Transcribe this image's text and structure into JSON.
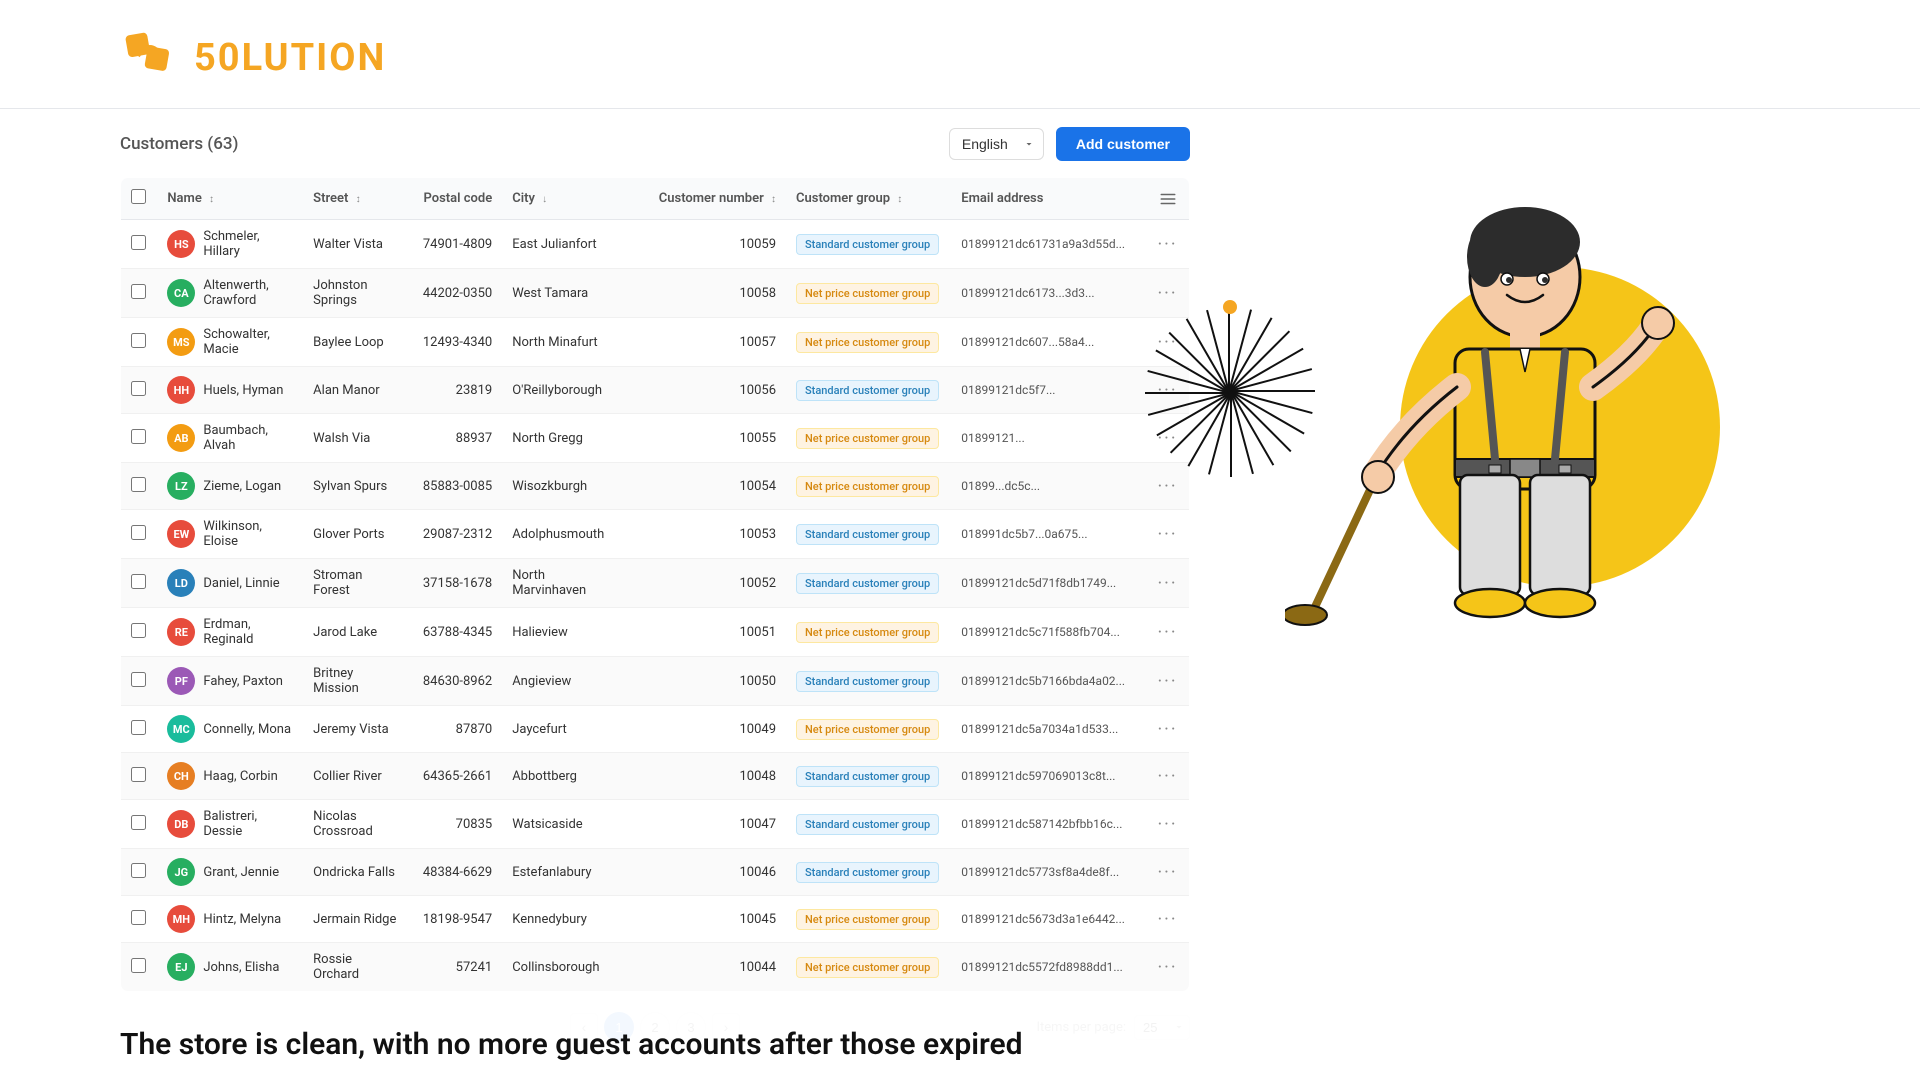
{
  "logo": {
    "text": "50LUTION"
  },
  "toolbar": {
    "title": "Customers (63)",
    "lang_label": "English",
    "add_button": "Add customer"
  },
  "table": {
    "columns": [
      "",
      "Name",
      "Street",
      "Postal code",
      "City",
      "",
      "Customer number",
      "Customer group",
      "Email address",
      ""
    ],
    "rows": [
      {
        "id": 1,
        "initials": "HS",
        "avatar_color": "#e74c3c",
        "name": "Schmeler, Hillary",
        "street": "Walter Vista",
        "postal": "74901-4809",
        "city": "East Julianfort",
        "custnum": "10059",
        "group": "Standard customer group",
        "group_type": "standard",
        "email": "01899121dc61731a9a3d55d..."
      },
      {
        "id": 2,
        "initials": "CA",
        "avatar_color": "#27ae60",
        "name": "Altenwerth, Crawford",
        "street": "Johnston Springs",
        "postal": "44202-0350",
        "city": "West Tamara",
        "custnum": "10058",
        "group": "Net price customer group",
        "group_type": "net",
        "email": "01899121dc6173...3d3..."
      },
      {
        "id": 3,
        "initials": "MS",
        "avatar_color": "#f39c12",
        "name": "Schowalter, Macie",
        "street": "Baylee Loop",
        "postal": "12493-4340",
        "city": "North Minafurt",
        "custnum": "10057",
        "group": "Net price customer group",
        "group_type": "net",
        "email": "01899121dc607...58a4..."
      },
      {
        "id": 4,
        "initials": "HH",
        "avatar_color": "#e74c3c",
        "name": "Huels, Hyman",
        "street": "Alan Manor",
        "postal": "23819",
        "city": "O'Reillyborough",
        "custnum": "10056",
        "group": "Standard customer group",
        "group_type": "standard",
        "email": "01899121dc5f7..."
      },
      {
        "id": 5,
        "initials": "AB",
        "avatar_color": "#f39c12",
        "name": "Baumbach, Alvah",
        "street": "Walsh Via",
        "postal": "88937",
        "city": "North Gregg",
        "custnum": "10055",
        "group": "Net price customer group",
        "group_type": "net",
        "email": "01899121..."
      },
      {
        "id": 6,
        "initials": "LZ",
        "avatar_color": "#27ae60",
        "name": "Zieme, Logan",
        "street": "Sylvan Spurs",
        "postal": "85883-0085",
        "city": "Wisozkburgh",
        "custnum": "10054",
        "group": "Net price customer group",
        "group_type": "net",
        "email": "01899...dc5c..."
      },
      {
        "id": 7,
        "initials": "EW",
        "avatar_color": "#e74c3c",
        "name": "Wilkinson, Eloise",
        "street": "Glover Ports",
        "postal": "29087-2312",
        "city": "Adolphusmouth",
        "custnum": "10053",
        "group": "Standard customer group",
        "group_type": "standard",
        "email": "018991dc5b7...0a675..."
      },
      {
        "id": 8,
        "initials": "LD",
        "avatar_color": "#2980b9",
        "name": "Daniel, Linnie",
        "street": "Stroman Forest",
        "postal": "37158-1678",
        "city": "North Marvinhaven",
        "custnum": "10052",
        "group": "Standard customer group",
        "group_type": "standard",
        "email": "01899121dc5d71f8db1749..."
      },
      {
        "id": 9,
        "initials": "RE",
        "avatar_color": "#e74c3c",
        "name": "Erdman, Reginald",
        "street": "Jarod Lake",
        "postal": "63788-4345",
        "city": "Halieview",
        "custnum": "10051",
        "group": "Net price customer group",
        "group_type": "net",
        "email": "01899121dc5c71f588fb704..."
      },
      {
        "id": 10,
        "initials": "PF",
        "avatar_color": "#9b59b6",
        "name": "Fahey, Paxton",
        "street": "Britney Mission",
        "postal": "84630-8962",
        "city": "Angieview",
        "custnum": "10050",
        "group": "Standard customer group",
        "group_type": "standard",
        "email": "01899121dc5b7166bda4a02..."
      },
      {
        "id": 11,
        "initials": "MC",
        "avatar_color": "#1abc9c",
        "name": "Connelly, Mona",
        "street": "Jeremy Vista",
        "postal": "87870",
        "city": "Jaycefurt",
        "custnum": "10049",
        "group": "Net price customer group",
        "group_type": "net",
        "email": "01899121dc5a7034a1d533..."
      },
      {
        "id": 12,
        "initials": "CH",
        "avatar_color": "#e67e22",
        "name": "Haag, Corbin",
        "street": "Collier River",
        "postal": "64365-2661",
        "city": "Abbottberg",
        "custnum": "10048",
        "group": "Standard customer group",
        "group_type": "standard",
        "email": "01899121dc597069013c8t..."
      },
      {
        "id": 13,
        "initials": "DB",
        "avatar_color": "#e74c3c",
        "name": "Balistreri, Dessie",
        "street": "Nicolas Crossroad",
        "postal": "70835",
        "city": "Watsicaside",
        "custnum": "10047",
        "group": "Standard customer group",
        "group_type": "standard",
        "email": "01899121dc587142bfbb16c..."
      },
      {
        "id": 14,
        "initials": "JG",
        "avatar_color": "#27ae60",
        "name": "Grant, Jennie",
        "street": "Ondricka Falls",
        "postal": "48384-6629",
        "city": "Estefanlabury",
        "custnum": "10046",
        "group": "Standard customer group",
        "group_type": "standard",
        "email": "01899121dc5773sf8a4de8f..."
      },
      {
        "id": 15,
        "initials": "MH",
        "avatar_color": "#e74c3c",
        "name": "Hintz, Melyna",
        "street": "Jermain Ridge",
        "postal": "18198-9547",
        "city": "Kennedybury",
        "custnum": "10045",
        "group": "Net price customer group",
        "group_type": "net",
        "email": "01899121dc5673d3a1e6442..."
      },
      {
        "id": 16,
        "initials": "EJ",
        "avatar_color": "#27ae60",
        "name": "Johns, Elisha",
        "street": "Rossie Orchard",
        "postal": "57241",
        "city": "Collinsborough",
        "custnum": "10044",
        "group": "Net price customer group",
        "group_type": "net",
        "email": "01899121dc5572fd8988dd1..."
      }
    ]
  },
  "pagination": {
    "pages": [
      "1",
      "2",
      "3"
    ],
    "current": "1",
    "items_per_page_label": "Items per page:",
    "items_per_page_value": "25"
  },
  "caption": {
    "text": "The store is clean, with no more guest accounts after those expired"
  },
  "detected": {
    "net_price": "Net Price",
    "standard_group": "Standard Customer group",
    "street_header": "Street"
  }
}
